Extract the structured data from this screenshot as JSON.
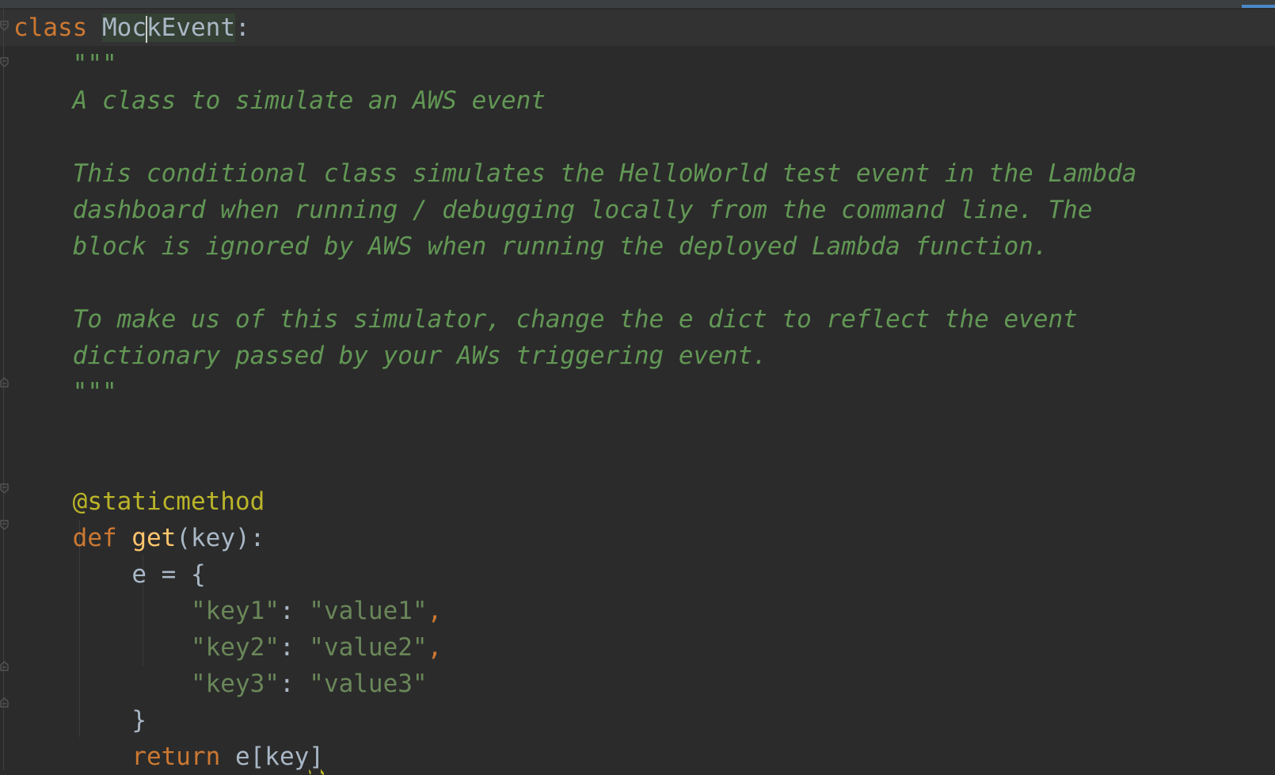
{
  "editor": {
    "lines": [
      {
        "id": "l1"
      },
      {
        "id": "l2"
      }
    ],
    "code": {
      "class_kw": "class",
      "class_name_a": "Moc",
      "class_name_b": "kEvent",
      "colon": ":",
      "doc_open": "\"\"\"",
      "doc_line1": "A class to simulate an AWS event",
      "doc_line2": "This conditional class simulates the HelloWorld test event in the Lambda",
      "doc_line3": "dashboard when running / debugging locally from the command line. The",
      "doc_line4": "block is ignored by AWS when running the deployed Lambda function.",
      "doc_line5": "To make us of this simulator, change the e dict to reflect the event",
      "doc_line6": "dictionary passed by your AWs triggering event.",
      "doc_close": "\"\"\"",
      "decorator": "@staticmethod",
      "def_kw": "def",
      "fn_name": "get",
      "fn_params": "(key):",
      "assign": "e = {",
      "k1": "\"key1\"",
      "v1": "\"value1\"",
      "k2": "\"key2\"",
      "v2": "\"value2\"",
      "k3": "\"key3\"",
      "v3": "\"value3\"",
      "kv_sep": ": ",
      "comma": ",",
      "close_brace": "}",
      "return_kw": "return",
      "return_expr_a": "e[key",
      "return_expr_b": "]"
    }
  },
  "colors": {
    "background": "#2b2b2b",
    "keyword": "#cc7832",
    "docstring": "#629755",
    "string": "#6a8759",
    "decorator": "#bbb529",
    "function": "#ffc66d",
    "default": "#a9b7c6"
  }
}
